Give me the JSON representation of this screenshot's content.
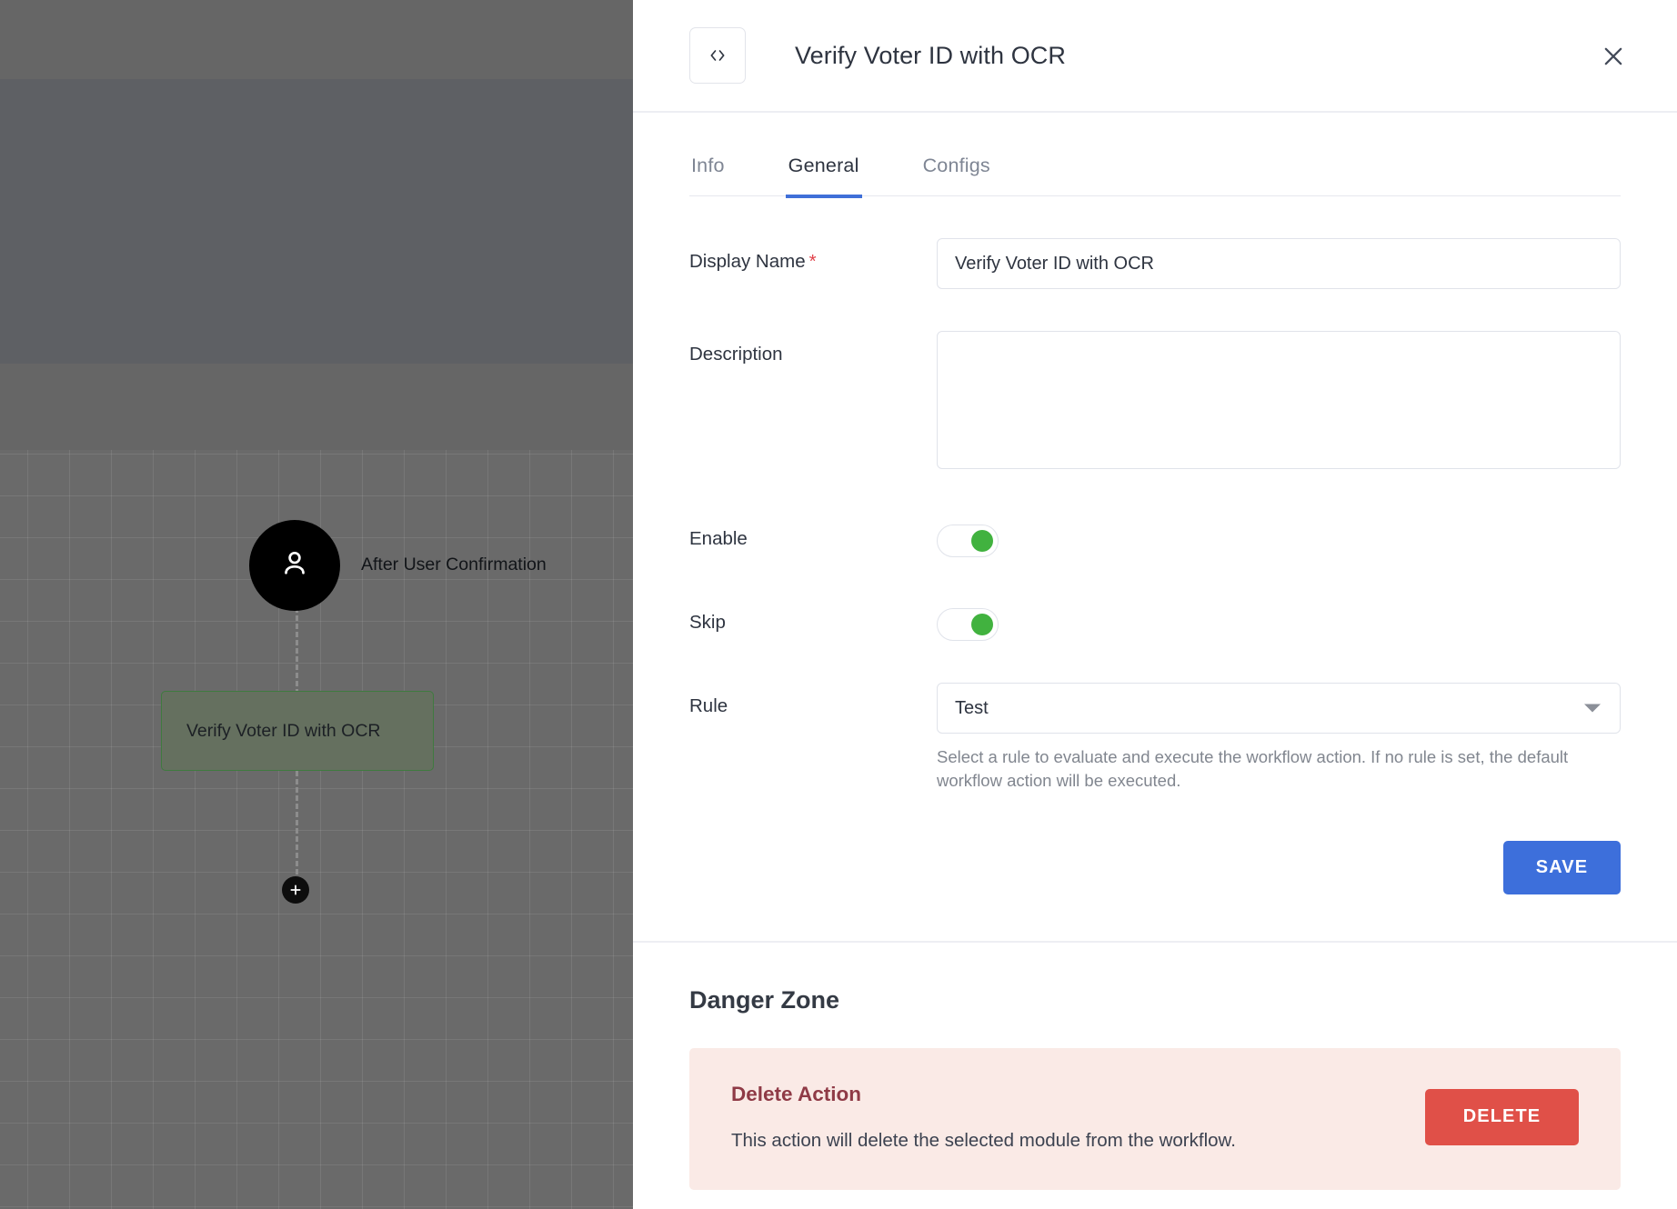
{
  "canvas": {
    "trigger": {
      "icon": "user-icon",
      "label": "After User Confirmation"
    },
    "action_node": {
      "label": "Verify Voter ID with OCR"
    },
    "add_button": {
      "icon": "plus-icon"
    }
  },
  "panel": {
    "header": {
      "badge_icon": "code-brackets-icon",
      "title": "Verify Voter ID with OCR",
      "close_icon": "close-icon"
    },
    "tabs": [
      {
        "label": "Info",
        "active": false
      },
      {
        "label": "General",
        "active": true
      },
      {
        "label": "Configs",
        "active": false
      }
    ],
    "form": {
      "display_name": {
        "label": "Display Name",
        "required_marker": "*",
        "value": "Verify Voter ID with OCR",
        "placeholder": ""
      },
      "description": {
        "label": "Description",
        "value": "",
        "placeholder": ""
      },
      "enable": {
        "label": "Enable",
        "state": "on"
      },
      "skip": {
        "label": "Skip",
        "state": "on"
      },
      "rule": {
        "label": "Rule",
        "value": "Test",
        "caret_icon": "chevron-down-icon",
        "hint": "Select a rule to evaluate and execute the workflow action. If no rule is set, the default workflow action will be executed.",
        "options": [
          "Test"
        ]
      },
      "save_label": "SAVE"
    },
    "danger_zone": {
      "title": "Danger Zone",
      "delete_heading": "Delete Action",
      "delete_description": "This action will delete the selected module from the workflow.",
      "delete_label": "DELETE"
    }
  },
  "colors": {
    "accent_blue": "#3d6fdb",
    "danger_red": "#e05048",
    "danger_bg": "#faeae6",
    "danger_heading": "#8f3a46",
    "toggle_on_green": "#41b23f",
    "node_green_border": "#3f7a3f"
  }
}
